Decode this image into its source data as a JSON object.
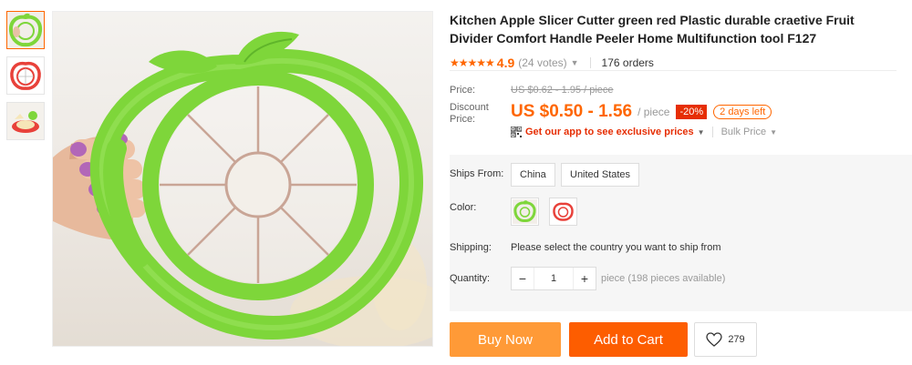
{
  "product": {
    "title": "Kitchen Apple Slicer Cutter green red Plastic durable craetive Fruit Divider Comfort Handle Peeler Home Multifunction tool F127"
  },
  "rating": {
    "stars": "★★★★★",
    "score": "4.9",
    "votes": "(24 votes)",
    "orders": "176 orders"
  },
  "price": {
    "label": "Price:",
    "old": "US $0.62 - 1.95 / piece",
    "discount_label_line1": "Discount",
    "discount_label_line2": "Price:",
    "current": "US $0.50 - 1.56",
    "unit": "/ piece",
    "discount": "-20%",
    "days_left": "2 days left"
  },
  "promo": {
    "app_text": "Get our app to see exclusive prices",
    "bulk": "Bulk Price"
  },
  "options": {
    "ships_from_label": "Ships From:",
    "ships_from": [
      "China",
      "United States"
    ],
    "color_label": "Color:",
    "colors": [
      "green",
      "red"
    ],
    "shipping_label": "Shipping:",
    "shipping_text": "Please select the country you want to ship from",
    "quantity_label": "Quantity:",
    "quantity_value": "1",
    "quantity_minus": "−",
    "quantity_plus": "+",
    "available": "piece (198 pieces available)"
  },
  "actions": {
    "buy_now": "Buy Now",
    "add_to_cart": "Add to Cart",
    "wishlist_count": "279"
  },
  "colors": {
    "accent": "#ff6600",
    "buy_now": "#ff9a37",
    "add_to_cart": "#fd5d00",
    "discount_badge": "#e62e04",
    "product_green": "#7ed63a",
    "product_red": "#e8413a"
  }
}
